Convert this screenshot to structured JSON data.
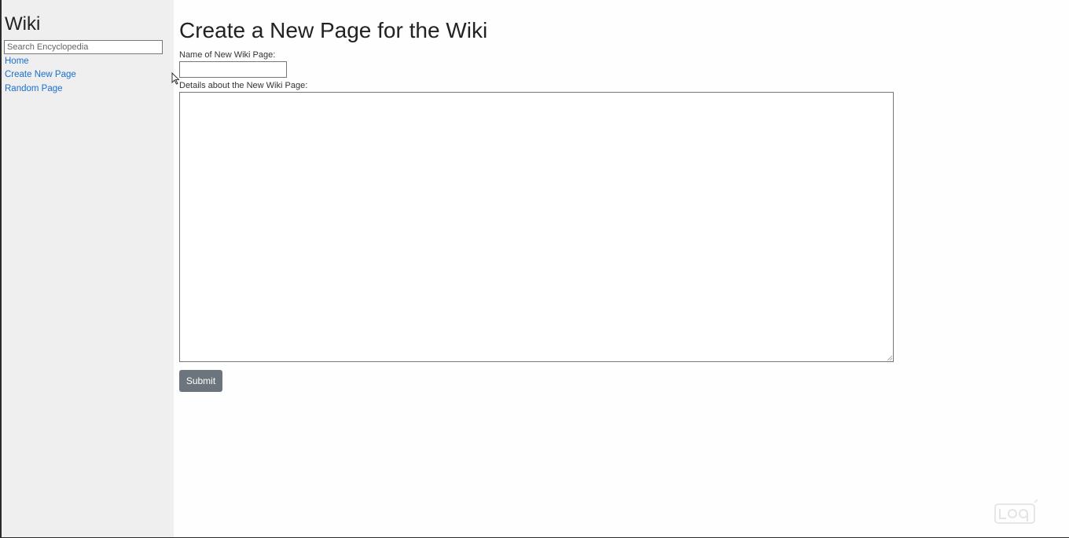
{
  "sidebar": {
    "brand": "Wiki",
    "search_placeholder": "Search Encyclopedia",
    "links": {
      "home": "Home",
      "create": "Create New Page",
      "random": "Random Page"
    }
  },
  "main": {
    "title": "Create a New Page for the Wiki",
    "name_label": "Name of New Wiki Page:",
    "name_value": "",
    "details_label": "Details about the New Wiki Page:",
    "details_value": "",
    "submit_label": "Submit"
  },
  "colors": {
    "link": "#1b6fd1",
    "sidebar_bg": "#eeefee",
    "button_bg": "#6c757d"
  },
  "icons": {
    "cursor": "mouse-pointer-icon",
    "watermark": "watermark-logo-icon"
  }
}
